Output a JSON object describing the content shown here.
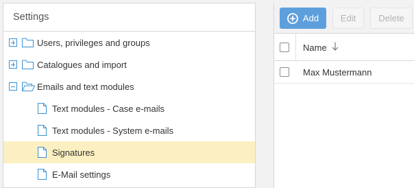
{
  "settings_panel": {
    "title": "Settings",
    "tree": [
      {
        "label": "Users, privileges and groups",
        "expander": "plus",
        "icon": "folder-icon"
      },
      {
        "label": "Catalogues and import",
        "expander": "plus",
        "icon": "folder-icon"
      },
      {
        "label": "Emails and text modules",
        "expander": "minus",
        "icon": "folder-open-icon"
      },
      {
        "label": "Text modules - Case e-mails",
        "icon": "document-icon"
      },
      {
        "label": "Text modules - System e-mails",
        "icon": "document-icon"
      },
      {
        "label": "Signatures",
        "icon": "document-icon",
        "selected": true
      },
      {
        "label": "E-Mail settings",
        "icon": "document-icon"
      }
    ]
  },
  "list_panel": {
    "toolbar": {
      "add_label": "Add",
      "edit_label": "Edit",
      "delete_label": "Delete"
    },
    "columns": [
      "Name"
    ],
    "sort_direction": "descending",
    "rows": [
      {
        "name": "Max Mustermann"
      }
    ]
  },
  "colors": {
    "accent": "#5d9fdc",
    "selected_row": "#fcf0c2",
    "tree_icon": "#3a8fd0"
  }
}
